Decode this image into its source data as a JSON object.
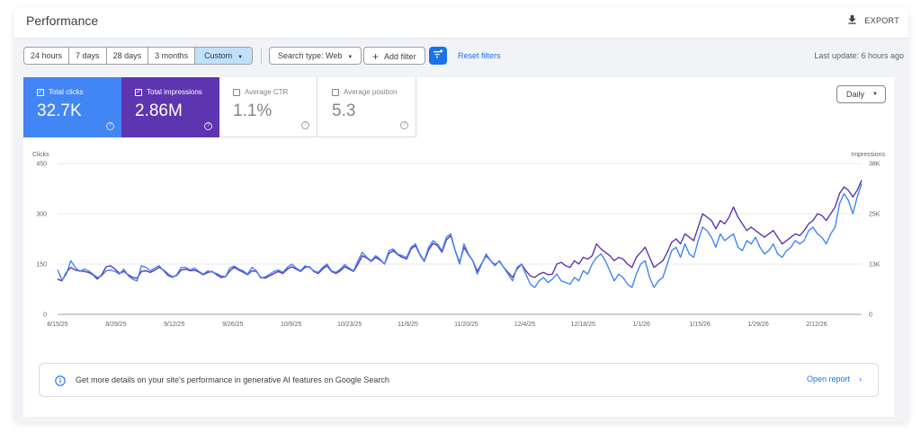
{
  "header": {
    "title": "Performance",
    "export_label": "EXPORT"
  },
  "filters": {
    "date_ranges": [
      {
        "label": "24 hours",
        "active": false
      },
      {
        "label": "7 days",
        "active": false
      },
      {
        "label": "28 days",
        "active": false
      },
      {
        "label": "3 months",
        "active": false
      },
      {
        "label": "Custom",
        "active": true
      }
    ],
    "search_type": "Search type: Web",
    "add_filter": "Add filter",
    "reset_filters": "Reset filters",
    "last_update": "Last update: 6 hours ago"
  },
  "metrics": [
    {
      "label": "Total clicks",
      "value": "32.7K",
      "selected": true,
      "color": "#4285f4"
    },
    {
      "label": "Total impressions",
      "value": "2.86M",
      "selected": true,
      "color": "#5e35b1"
    },
    {
      "label": "Average CTR",
      "value": "1.1%",
      "selected": false,
      "color": "#ffffff"
    },
    {
      "label": "Average position",
      "value": "5.3",
      "selected": false,
      "color": "#ffffff"
    }
  ],
  "granularity": "Daily",
  "chart_data": {
    "type": "line",
    "x": [
      "8/15/25",
      "8/29/25",
      "9/12/25",
      "9/26/25",
      "10/9/25",
      "10/23/25",
      "11/6/25",
      "11/20/25",
      "12/4/25",
      "12/18/25",
      "1/1/26",
      "1/15/26",
      "1/29/26",
      "2/12/26"
    ],
    "left_axis": {
      "label": "Clicks",
      "ticks": [
        "0",
        "150",
        "300",
        "450"
      ],
      "range": [
        0,
        450
      ]
    },
    "right_axis": {
      "label": "Impressions",
      "ticks": [
        "0",
        "13K",
        "25K",
        "38K"
      ],
      "range": [
        0,
        38000
      ]
    },
    "series": [
      {
        "name": "Total clicks",
        "axis": "left",
        "color": "#4285f4",
        "values": [
          133,
          102,
          120,
          160,
          140,
          128,
          135,
          130,
          120,
          110,
          115,
          130,
          132,
          128,
          120,
          135,
          115,
          105,
          100,
          145,
          140,
          130,
          138,
          145,
          130,
          115,
          110,
          118,
          140,
          140,
          132,
          138,
          128,
          120,
          130,
          126,
          122,
          115,
          112,
          138,
          144,
          135,
          130,
          120,
          140,
          130,
          108,
          112,
          120,
          128,
          132,
          125,
          140,
          150,
          138,
          130,
          145,
          140,
          130,
          125,
          140,
          150,
          130,
          125,
          135,
          148,
          138,
          130,
          160,
          185,
          170,
          160,
          175,
          165,
          150,
          190,
          195,
          180,
          175,
          170,
          200,
          210,
          180,
          160,
          200,
          220,
          210,
          190,
          230,
          240,
          190,
          150,
          210,
          180,
          160,
          120,
          150,
          180,
          160,
          145,
          160,
          140,
          120,
          100,
          140,
          150,
          120,
          90,
          80,
          100,
          110,
          95,
          105,
          120,
          100,
          95,
          90,
          110,
          100,
          130,
          120,
          150,
          170,
          180,
          160,
          130,
          100,
          120,
          110,
          90,
          80,
          120,
          150,
          160,
          110,
          80,
          100,
          110,
          150,
          190,
          200,
          170,
          210,
          180,
          170,
          220,
          260,
          250,
          230,
          200,
          240,
          220,
          230,
          240,
          200,
          190,
          220,
          210,
          230,
          200,
          180,
          190,
          210,
          180,
          170,
          190,
          200,
          220,
          210,
          220,
          250,
          260,
          240,
          230,
          210,
          240,
          260,
          330,
          360,
          340,
          300,
          350,
          390
        ]
      },
      {
        "name": "Total impressions",
        "axis": "left",
        "color": "#5e35b1",
        "values": [
          105,
          100,
          125,
          140,
          132,
          130,
          128,
          125,
          118,
          105,
          118,
          142,
          145,
          135,
          122,
          128,
          118,
          110,
          108,
          128,
          130,
          125,
          132,
          140,
          132,
          120,
          112,
          116,
          132,
          135,
          130,
          132,
          126,
          118,
          125,
          128,
          118,
          110,
          112,
          130,
          140,
          132,
          126,
          118,
          130,
          128,
          110,
          108,
          115,
          122,
          128,
          122,
          135,
          142,
          135,
          128,
          140,
          142,
          128,
          122,
          135,
          145,
          128,
          122,
          130,
          142,
          135,
          128,
          150,
          175,
          168,
          158,
          170,
          162,
          150,
          182,
          190,
          178,
          170,
          165,
          195,
          205,
          178,
          158,
          192,
          212,
          205,
          185,
          222,
          235,
          190,
          155,
          200,
          178,
          160,
          128,
          152,
          175,
          160,
          148,
          158,
          140,
          125,
          110,
          135,
          150,
          130,
          115,
          110,
          120,
          125,
          118,
          120,
          150,
          155,
          145,
          140,
          160,
          150,
          170,
          165,
          175,
          210,
          195,
          185,
          175,
          160,
          170,
          165,
          150,
          140,
          170,
          185,
          200,
          170,
          140,
          150,
          160,
          185,
          215,
          225,
          210,
          240,
          230,
          220,
          260,
          300,
          290,
          280,
          255,
          280,
          270,
          290,
          320,
          290,
          270,
          250,
          260,
          250,
          240,
          230,
          240,
          250,
          230,
          210,
          220,
          230,
          240,
          235,
          250,
          270,
          280,
          300,
          295,
          280,
          300,
          320,
          360,
          380,
          370,
          350,
          370,
          400
        ]
      }
    ]
  },
  "banner": {
    "message": "Get more details on your site's performance in generative AI features on Google Search",
    "link": "Open report"
  }
}
